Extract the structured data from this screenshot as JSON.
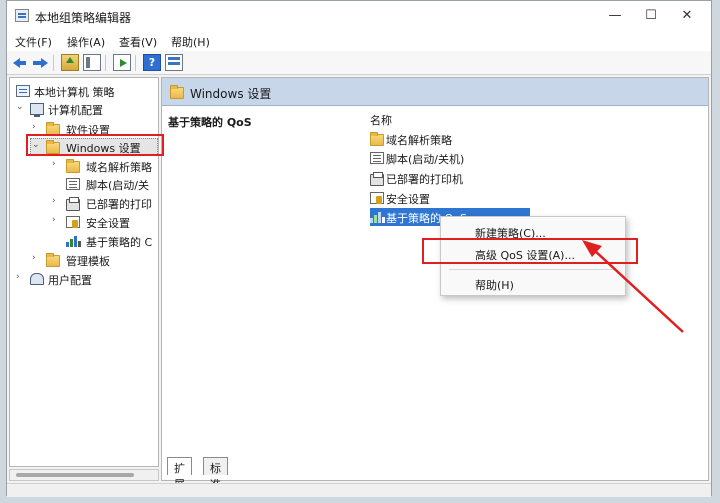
{
  "window": {
    "title": "本地组策略编辑器",
    "min": "—",
    "max": "☐",
    "close": "✕"
  },
  "menu": [
    "文件(F)",
    "操作(A)",
    "查看(V)",
    "帮助(H)"
  ],
  "tree": {
    "root": "本地计算机 策略",
    "computer_config": "计算机配置",
    "software_settings": "软件设置",
    "windows_settings": "Windows 设置",
    "dns": "域名解析策略",
    "scripts": "脚本(启动/关",
    "printers": "已部署的打印",
    "security": "安全设置",
    "qos": "基于策略的 C",
    "admin_templates": "管理模板",
    "user_config": "用户配置"
  },
  "content": {
    "header_title": "Windows 设置",
    "description_title": "基于策略的 QoS",
    "column_name": "名称",
    "items": [
      "域名解析策略",
      "脚本(启动/关机)",
      "已部署的打印机",
      "安全设置",
      "基于策略的 QoS"
    ]
  },
  "context_menu": {
    "new_policy": "新建策略(C)...",
    "advanced_qos": "高级 QoS 设置(A)...",
    "help": "帮助(H)"
  },
  "tabs": {
    "extended": "扩展",
    "standard": "标准"
  },
  "colors": {
    "highlight": "#e02020",
    "selection": "#2f76d3",
    "header": "#c7d6e8"
  }
}
